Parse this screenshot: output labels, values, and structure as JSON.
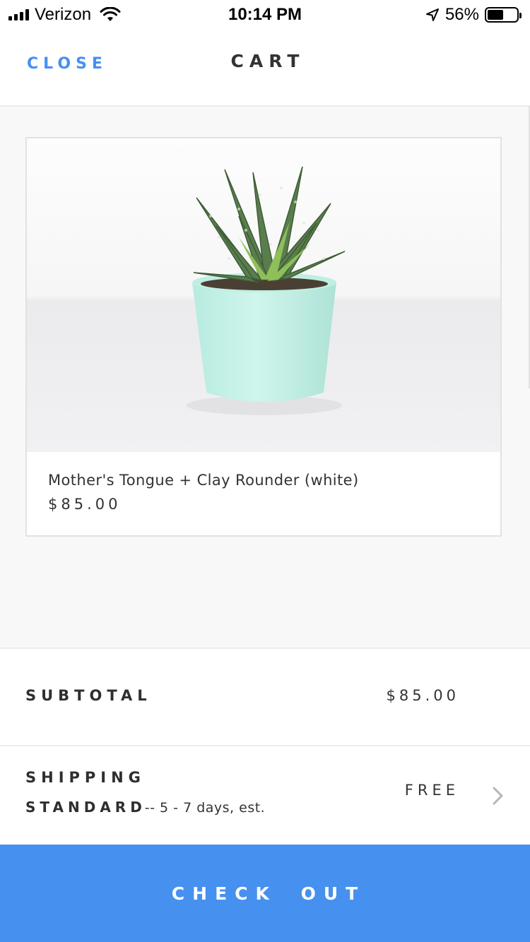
{
  "status_bar": {
    "carrier": "Verizon",
    "time": "10:14 PM",
    "battery_percent": "56%",
    "battery_level": 0.56,
    "icons": [
      "signal-icon",
      "wifi-icon",
      "location-arrow-icon",
      "battery-icon"
    ]
  },
  "header": {
    "close_label": "CLOSE",
    "title": "CART"
  },
  "cart": {
    "items": [
      {
        "name": "Mother's Tongue + Clay Rounder (white)",
        "price": "$85.00",
        "image": "succulent-plant-in-mint-pot"
      }
    ]
  },
  "summary": {
    "subtotal_label": "SUBTOTAL",
    "subtotal_value": "$85.00",
    "shipping_label": "SHIPPING",
    "shipping_method": "STANDARD",
    "shipping_desc": "-- 5 - 7 days, est.",
    "shipping_value": "FREE"
  },
  "checkout": {
    "label": "CHECK OUT"
  },
  "colors": {
    "accent": "#4690ef",
    "text": "#333333",
    "background": "#f8f8f8",
    "pot": "#c4f0e6",
    "leaf": "#5a7d4e"
  }
}
